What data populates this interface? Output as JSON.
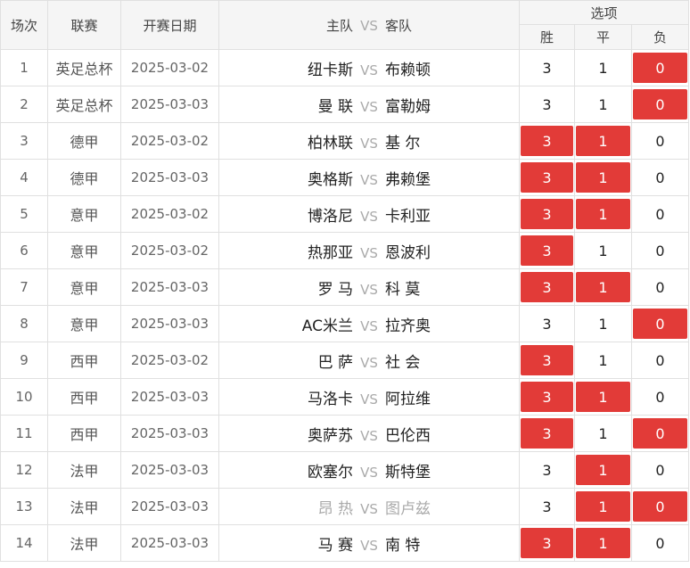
{
  "header": {
    "no": "场次",
    "league": "联赛",
    "date": "开赛日期",
    "home": "主队",
    "vs": "VS",
    "away": "客队",
    "options": "选项",
    "win": "胜",
    "draw": "平",
    "lose": "负"
  },
  "colors": {
    "selected": "#e23b38",
    "unselected": "#ffffff"
  },
  "rows": [
    {
      "no": "1",
      "league": "英足总杯",
      "date": "2025-03-02",
      "home": "纽卡斯",
      "away": "布赖顿",
      "win": "3",
      "draw": "1",
      "lose": "0",
      "sel": [
        false,
        false,
        true
      ],
      "dim": false
    },
    {
      "no": "2",
      "league": "英足总杯",
      "date": "2025-03-03",
      "home": "曼 联",
      "away": "富勒姆",
      "win": "3",
      "draw": "1",
      "lose": "0",
      "sel": [
        false,
        false,
        true
      ],
      "dim": false
    },
    {
      "no": "3",
      "league": "德甲",
      "date": "2025-03-02",
      "home": "柏林联",
      "away": "基 尔",
      "win": "3",
      "draw": "1",
      "lose": "0",
      "sel": [
        true,
        true,
        false
      ],
      "dim": false
    },
    {
      "no": "4",
      "league": "德甲",
      "date": "2025-03-03",
      "home": "奥格斯",
      "away": "弗赖堡",
      "win": "3",
      "draw": "1",
      "lose": "0",
      "sel": [
        true,
        true,
        false
      ],
      "dim": false
    },
    {
      "no": "5",
      "league": "意甲",
      "date": "2025-03-02",
      "home": "博洛尼",
      "away": "卡利亚",
      "win": "3",
      "draw": "1",
      "lose": "0",
      "sel": [
        true,
        true,
        false
      ],
      "dim": false
    },
    {
      "no": "6",
      "league": "意甲",
      "date": "2025-03-02",
      "home": "热那亚",
      "away": "恩波利",
      "win": "3",
      "draw": "1",
      "lose": "0",
      "sel": [
        true,
        false,
        false
      ],
      "dim": false
    },
    {
      "no": "7",
      "league": "意甲",
      "date": "2025-03-03",
      "home": "罗 马",
      "away": "科 莫",
      "win": "3",
      "draw": "1",
      "lose": "0",
      "sel": [
        true,
        true,
        false
      ],
      "dim": false
    },
    {
      "no": "8",
      "league": "意甲",
      "date": "2025-03-03",
      "home": "AC米兰",
      "away": "拉齐奥",
      "win": "3",
      "draw": "1",
      "lose": "0",
      "sel": [
        false,
        false,
        true
      ],
      "dim": false
    },
    {
      "no": "9",
      "league": "西甲",
      "date": "2025-03-02",
      "home": "巴 萨",
      "away": "社 会",
      "win": "3",
      "draw": "1",
      "lose": "0",
      "sel": [
        true,
        false,
        false
      ],
      "dim": false
    },
    {
      "no": "10",
      "league": "西甲",
      "date": "2025-03-03",
      "home": "马洛卡",
      "away": "阿拉维",
      "win": "3",
      "draw": "1",
      "lose": "0",
      "sel": [
        true,
        true,
        false
      ],
      "dim": false
    },
    {
      "no": "11",
      "league": "西甲",
      "date": "2025-03-03",
      "home": "奥萨苏",
      "away": "巴伦西",
      "win": "3",
      "draw": "1",
      "lose": "0",
      "sel": [
        true,
        false,
        true
      ],
      "dim": false
    },
    {
      "no": "12",
      "league": "法甲",
      "date": "2025-03-03",
      "home": "欧塞尔",
      "away": "斯特堡",
      "win": "3",
      "draw": "1",
      "lose": "0",
      "sel": [
        false,
        true,
        false
      ],
      "dim": false
    },
    {
      "no": "13",
      "league": "法甲",
      "date": "2025-03-03",
      "home": "昂 热",
      "away": "图卢兹",
      "win": "3",
      "draw": "1",
      "lose": "0",
      "sel": [
        false,
        true,
        true
      ],
      "dim": true
    },
    {
      "no": "14",
      "league": "法甲",
      "date": "2025-03-03",
      "home": "马 赛",
      "away": "南 特",
      "win": "3",
      "draw": "1",
      "lose": "0",
      "sel": [
        true,
        true,
        false
      ],
      "dim": false
    }
  ]
}
